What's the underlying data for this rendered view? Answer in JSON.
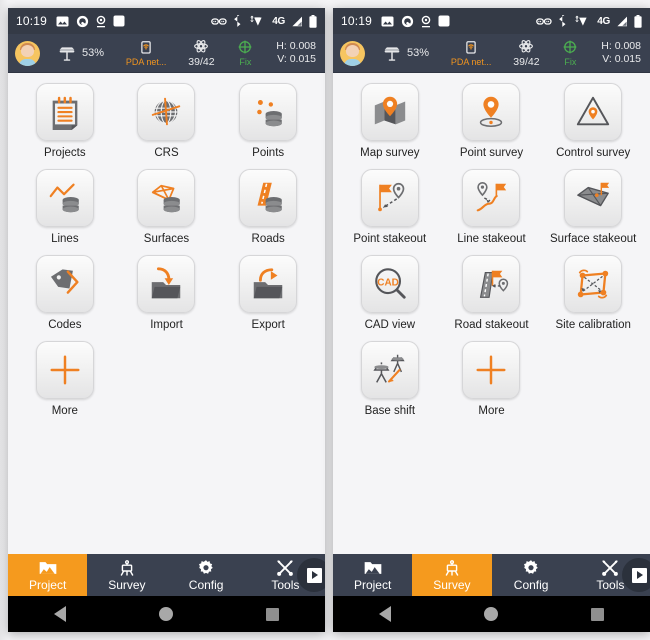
{
  "statusbar": {
    "time": "10:19",
    "left_icons": [
      "image-icon",
      "quickpic-icon",
      "location-icon",
      "app-square-icon"
    ],
    "right_icons": [
      "link-icon",
      "bluetooth-icon",
      "wifi-icon",
      "mobile-signal-icon",
      "battery-icon"
    ],
    "network_label": "4G"
  },
  "appbar": {
    "avatar": "user-avatar",
    "antenna_icon": "gnss-antenna-icon",
    "battery_percent": "53%",
    "network_icon": "pda-network-icon",
    "network_label": "PDA net...",
    "satellite_icon": "satellite-icon",
    "satellite_count": "39/42",
    "fix_icon": "fix-target-icon",
    "fix_label": "Fix",
    "h_accuracy": "H: 0.008",
    "v_accuracy": "V: 0.015"
  },
  "colors": {
    "accent": "#f59a1e",
    "header_bg": "#3a4150",
    "statusbar_bg": "#343a46",
    "content_bg": "#f5f5f7",
    "fix_green": "#4caf50",
    "label_orange": "#f0941f"
  },
  "panels": [
    {
      "id": "project-panel",
      "items": [
        {
          "label": "Projects",
          "icon": "projects-notebook-icon"
        },
        {
          "label": "CRS",
          "icon": "crs-globe-icon"
        },
        {
          "label": "Points",
          "icon": "points-database-icon"
        },
        {
          "label": "Lines",
          "icon": "lines-database-icon"
        },
        {
          "label": "Surfaces",
          "icon": "surfaces-database-icon"
        },
        {
          "label": "Roads",
          "icon": "roads-database-icon"
        },
        {
          "label": "Codes",
          "icon": "codes-tag-icon"
        },
        {
          "label": "Import",
          "icon": "import-folder-icon"
        },
        {
          "label": "Export",
          "icon": "export-folder-icon"
        },
        {
          "label": "More",
          "icon": "more-plus-icon"
        }
      ],
      "tabs": [
        {
          "label": "Project",
          "icon": "project-folder-icon",
          "active": true
        },
        {
          "label": "Survey",
          "icon": "survey-tripod-icon",
          "active": false
        },
        {
          "label": "Config",
          "icon": "config-gear-icon",
          "active": false
        },
        {
          "label": "Tools",
          "icon": "tools-wrench-icon",
          "active": false
        }
      ],
      "overflow": "more-tabs-arrow-icon"
    },
    {
      "id": "survey-panel",
      "items": [
        {
          "label": "Map survey",
          "icon": "map-survey-icon"
        },
        {
          "label": "Point survey",
          "icon": "point-survey-icon"
        },
        {
          "label": "Control survey",
          "icon": "control-survey-icon"
        },
        {
          "label": "Point stakeout",
          "icon": "point-stakeout-icon"
        },
        {
          "label": "Line stakeout",
          "icon": "line-stakeout-icon"
        },
        {
          "label": "Surface stakeout",
          "icon": "surface-stakeout-icon"
        },
        {
          "label": "CAD view",
          "icon": "cad-view-icon"
        },
        {
          "label": "Road stakeout",
          "icon": "road-stakeout-icon"
        },
        {
          "label": "Site calibration",
          "icon": "site-calibration-icon"
        },
        {
          "label": "Base shift",
          "icon": "base-shift-icon"
        },
        {
          "label": "More",
          "icon": "more-plus-icon"
        }
      ],
      "tabs": [
        {
          "label": "Project",
          "icon": "project-folder-icon",
          "active": false
        },
        {
          "label": "Survey",
          "icon": "survey-tripod-icon",
          "active": true
        },
        {
          "label": "Config",
          "icon": "config-gear-icon",
          "active": false
        },
        {
          "label": "Tools",
          "icon": "tools-wrench-icon",
          "active": false
        }
      ],
      "overflow": "more-tabs-arrow-icon"
    }
  ],
  "navbar": {
    "back": "back-triangle-icon",
    "home": "home-circle-icon",
    "recents": "recents-square-icon"
  }
}
